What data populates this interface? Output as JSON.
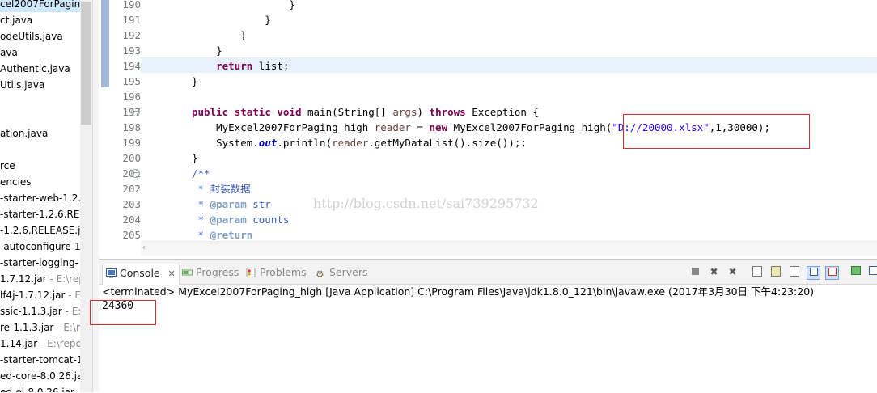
{
  "explorer": {
    "items": [
      {
        "text": "cel2007ForPaging",
        "path": ""
      },
      {
        "text": "ct.java",
        "path": ""
      },
      {
        "text": "odeUtils.java",
        "path": ""
      },
      {
        "text": "ava",
        "path": ""
      },
      {
        "text": "Authentic.java",
        "path": ""
      },
      {
        "text": "Utils.java",
        "path": ""
      },
      {
        "text": "",
        "path": ""
      },
      {
        "text": "",
        "path": ""
      },
      {
        "text": "ation.java",
        "path": ""
      },
      {
        "text": "",
        "path": ""
      },
      {
        "text": "rce",
        "path": ""
      },
      {
        "text": "encies",
        "path": ""
      },
      {
        "text": "-starter-web-1.2.",
        "path": ""
      },
      {
        "text": "-starter-1.2.6.REL",
        "path": ""
      },
      {
        "text": "-1.2.6.RELEASE.ja",
        "path": ""
      },
      {
        "text": "-autoconfigure-1",
        "path": ""
      },
      {
        "text": "-starter-logging-",
        "path": ""
      },
      {
        "text": "1.7.12.jar",
        "path": " - E:\\repo"
      },
      {
        "text": "lf4j-1.7.12.jar",
        "path": " - E:"
      },
      {
        "text": "ssic-1.1.3.jar",
        "path": " - E:\\"
      },
      {
        "text": "re-1.1.3.jar",
        "path": " - E:\\re"
      },
      {
        "text": "1.14.jar",
        "path": " - E:\\repos"
      },
      {
        "text": "-starter-tomcat-1",
        "path": ""
      },
      {
        "text": "ed-core-8.0.26.ja",
        "path": ""
      },
      {
        "text": "ed-el-8.0.26.jar",
        "path": ""
      }
    ]
  },
  "editor": {
    "line_numbers": [
      "190",
      "191",
      "192",
      "193",
      "194",
      "195",
      "196",
      "197",
      "198",
      "199",
      "200",
      "201",
      "202",
      "203",
      "204",
      "205"
    ],
    "lines": [
      [
        {
          "t": "                }",
          "c": ""
        }
      ],
      [
        {
          "t": "            }",
          "c": ""
        }
      ],
      [
        {
          "t": "        }",
          "c": ""
        }
      ],
      [
        {
          "t": "    }",
          "c": ""
        }
      ],
      [
        {
          "t": "    ",
          "c": ""
        },
        {
          "t": "return",
          "c": "kw"
        },
        {
          "t": " list;",
          "c": ""
        }
      ],
      [
        {
          "t": "}",
          "c": ""
        }
      ],
      [
        {
          "t": "",
          "c": ""
        }
      ],
      [
        {
          "t": "public",
          "c": "kw"
        },
        {
          "t": " ",
          "c": ""
        },
        {
          "t": "static",
          "c": "kw"
        },
        {
          "t": " ",
          "c": ""
        },
        {
          "t": "void",
          "c": "kw"
        },
        {
          "t": " main(String[] ",
          "c": ""
        },
        {
          "t": "args",
          "c": "param"
        },
        {
          "t": ") ",
          "c": ""
        },
        {
          "t": "throws",
          "c": "kw"
        },
        {
          "t": " Exception {",
          "c": ""
        }
      ],
      [
        {
          "t": "    MyExcel2007ForPaging_high ",
          "c": ""
        },
        {
          "t": "reader",
          "c": "param"
        },
        {
          "t": " = ",
          "c": ""
        },
        {
          "t": "new",
          "c": "kw"
        },
        {
          "t": " MyExcel2007ForPaging_high(",
          "c": ""
        },
        {
          "t": "\"D://20000.xlsx\"",
          "c": "str"
        },
        {
          "t": ",1,30000);",
          "c": ""
        }
      ],
      [
        {
          "t": "    System.",
          "c": ""
        },
        {
          "t": "out",
          "c": "field"
        },
        {
          "t": ".println(",
          "c": ""
        },
        {
          "t": "reader",
          "c": "param"
        },
        {
          "t": ".getMyDataList().size());;",
          "c": ""
        }
      ],
      [
        {
          "t": "}",
          "c": ""
        }
      ],
      [
        {
          "t": "/**",
          "c": "cmt"
        }
      ],
      [
        {
          "t": " * 封装数据",
          "c": "cmt"
        }
      ],
      [
        {
          "t": " * ",
          "c": "cmt"
        },
        {
          "t": "@param",
          "c": "tag"
        },
        {
          "t": " str",
          "c": "cmt"
        }
      ],
      [
        {
          "t": " * ",
          "c": "cmt"
        },
        {
          "t": "@param",
          "c": "tag"
        },
        {
          "t": " counts",
          "c": "cmt"
        }
      ],
      [
        {
          "t": " * ",
          "c": "cmt"
        },
        {
          "t": "@return",
          "c": "tag"
        }
      ]
    ],
    "watermark": "http://blog.csdn.net/sai739295732"
  },
  "console": {
    "tabs": {
      "console": "Console",
      "progress": "Progress",
      "problems": "Problems",
      "servers": "Servers"
    },
    "status_line": "<terminated> MyExcel2007ForPaging_high [Java Application] C:\\Program Files\\Java\\jdk1.8.0_121\\bin\\javaw.exe (2017年3月30日 下午4:23:20)",
    "output": "24360"
  },
  "colors": {
    "highlight": "#e32a2a",
    "keyword": "#7f0055",
    "string": "#2a00ff",
    "comment": "#3f5fbf"
  }
}
